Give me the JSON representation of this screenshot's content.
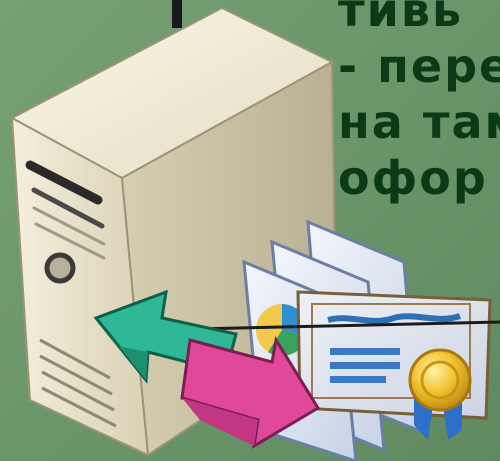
{
  "text_lines": [
    "тивь",
    "- пере",
    "на там",
    "офор"
  ],
  "colors": {
    "background": "#6f9a6e",
    "text": "#0b3a17",
    "server": "#e8e2cc",
    "arrow_teal": "#2fb896",
    "arrow_pink": "#e0489a",
    "certificate": "#c9d7ec",
    "seal_gold": "#e6b21e"
  },
  "icons": [
    "server-icon",
    "certificate-icon",
    "exchange-arrows-icon",
    "award-seal-icon"
  ]
}
